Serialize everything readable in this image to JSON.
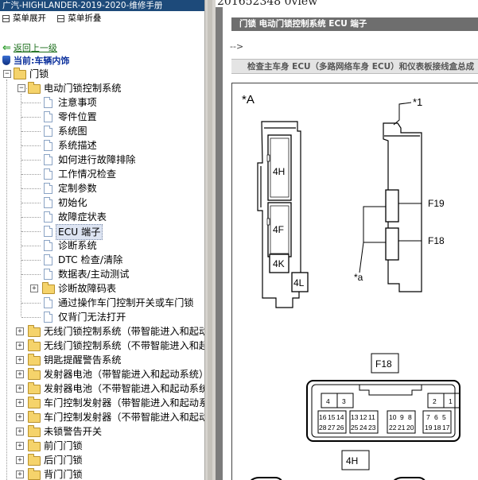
{
  "left_panel": {
    "title": "广汽-HIGHLANDER-2019-2020-维修手册",
    "expand_all": "菜单展开",
    "collapse_all": "菜单折叠",
    "back_link": "返回上一级",
    "current_label": "当前:",
    "current_value": "车辆内饰"
  },
  "tree": {
    "root": "门锁",
    "folder": "电动门锁控制系统",
    "children": [
      "注意事项",
      "零件位置",
      "系统图",
      "系统描述",
      "如何进行故障排除",
      "工作情况检查",
      "定制参数",
      "初始化",
      "故障症状表",
      "ECU 端子",
      "诊断系统",
      "DTC 检查/清除",
      "数据表/主动测试",
      "诊断故障码表",
      "通过操作车门控制开关或车门锁",
      "仅背门无法打开"
    ],
    "siblings": [
      "无线门锁控制系统（带智能进入和起动系统）",
      "无线门锁控制系统（不带智能进入和起动系统）",
      "钥匙提醒警告系统",
      "发射器电池（带智能进入和起动系统）",
      "发射器电池（不带智能进入和起动系统）",
      "车门控制发射器（带智能进入和起动系统）",
      "车门控制发射器（不带智能进入和起动系统）",
      "未锁警告开关",
      "前门门锁",
      "后门门锁",
      "背门门锁"
    ]
  },
  "content": {
    "url_fragment": "201652348 0view",
    "header": "门锁  电动门锁控制系统  ECU 端子",
    "arrow_text": "-->",
    "subheader": "检查主车身 ECU（多路网络车身 ECU）和仪表板接线盒总成"
  },
  "diagram": {
    "marker_a": "*A",
    "marker_1": "*1",
    "marker_small_a": "*a",
    "connectors_left": [
      "4H",
      "4F",
      "4K",
      "4L"
    ],
    "connectors_right": [
      "F19",
      "F18"
    ],
    "f18_label": "F18",
    "f18_top_left": [
      "4",
      "3"
    ],
    "f18_top_right": [
      "2",
      "1"
    ],
    "f18_row1": [
      "16",
      "15",
      "14",
      "13",
      "12",
      "11",
      "10",
      "9",
      "8",
      "7",
      "6",
      "5"
    ],
    "f18_row2": [
      "28",
      "27",
      "26",
      "25",
      "24",
      "23",
      "22",
      "21",
      "20",
      "19",
      "18",
      "17"
    ],
    "h4_label": "4H"
  }
}
